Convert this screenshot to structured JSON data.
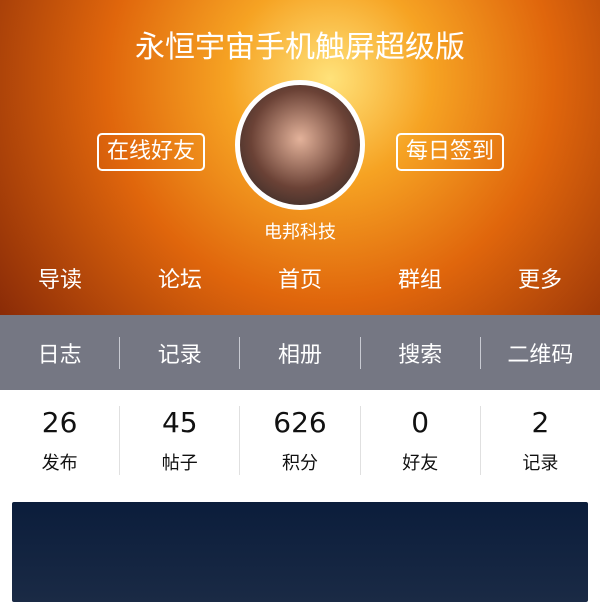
{
  "header": {
    "title": "永恒宇宙手机触屏超级版",
    "left_button": "在线好友",
    "right_button": "每日签到",
    "username": "电邦科技"
  },
  "nav": [
    "导读",
    "论坛",
    "首页",
    "群组",
    "更多"
  ],
  "subnav": [
    "日志",
    "记录",
    "相册",
    "搜索",
    "二维码"
  ],
  "stats": [
    {
      "value": "26",
      "label": "发布"
    },
    {
      "value": "45",
      "label": "帖子"
    },
    {
      "value": "626",
      "label": "积分"
    },
    {
      "value": "0",
      "label": "好友"
    },
    {
      "value": "2",
      "label": "记录"
    }
  ]
}
